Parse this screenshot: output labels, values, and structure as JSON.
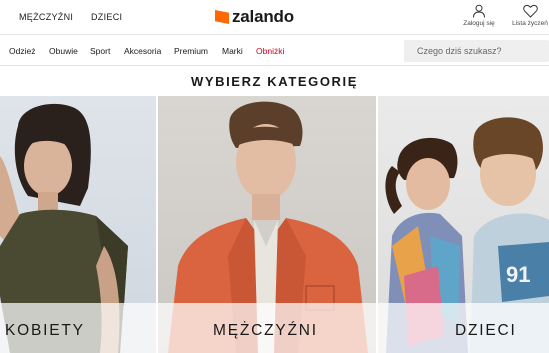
{
  "header": {
    "gender_links": [
      "MĘŻCZYŹNI",
      "DZIECI"
    ],
    "logo_text": "zalando",
    "account_label": "Zaloguj się",
    "wishlist_label": "Lista życzeń",
    "account_icon": "user-icon",
    "wishlist_icon": "heart-icon"
  },
  "catnav": {
    "items": [
      "Odzież",
      "Obuwie",
      "Sport",
      "Akcesoria",
      "Premium",
      "Marki",
      "Obniżki"
    ],
    "search_placeholder": "Czego dziś szukasz?"
  },
  "main": {
    "heading": "WYBIERZ KATEGORIĘ",
    "tiles": [
      {
        "label": "KOBIETY"
      },
      {
        "label": "MĘŻCZYŹNI"
      },
      {
        "label": "DZIECI"
      }
    ]
  },
  "colors": {
    "brand_orange": "#ff6900",
    "sale_red": "#d0021b",
    "text": "#1a1a1a"
  }
}
